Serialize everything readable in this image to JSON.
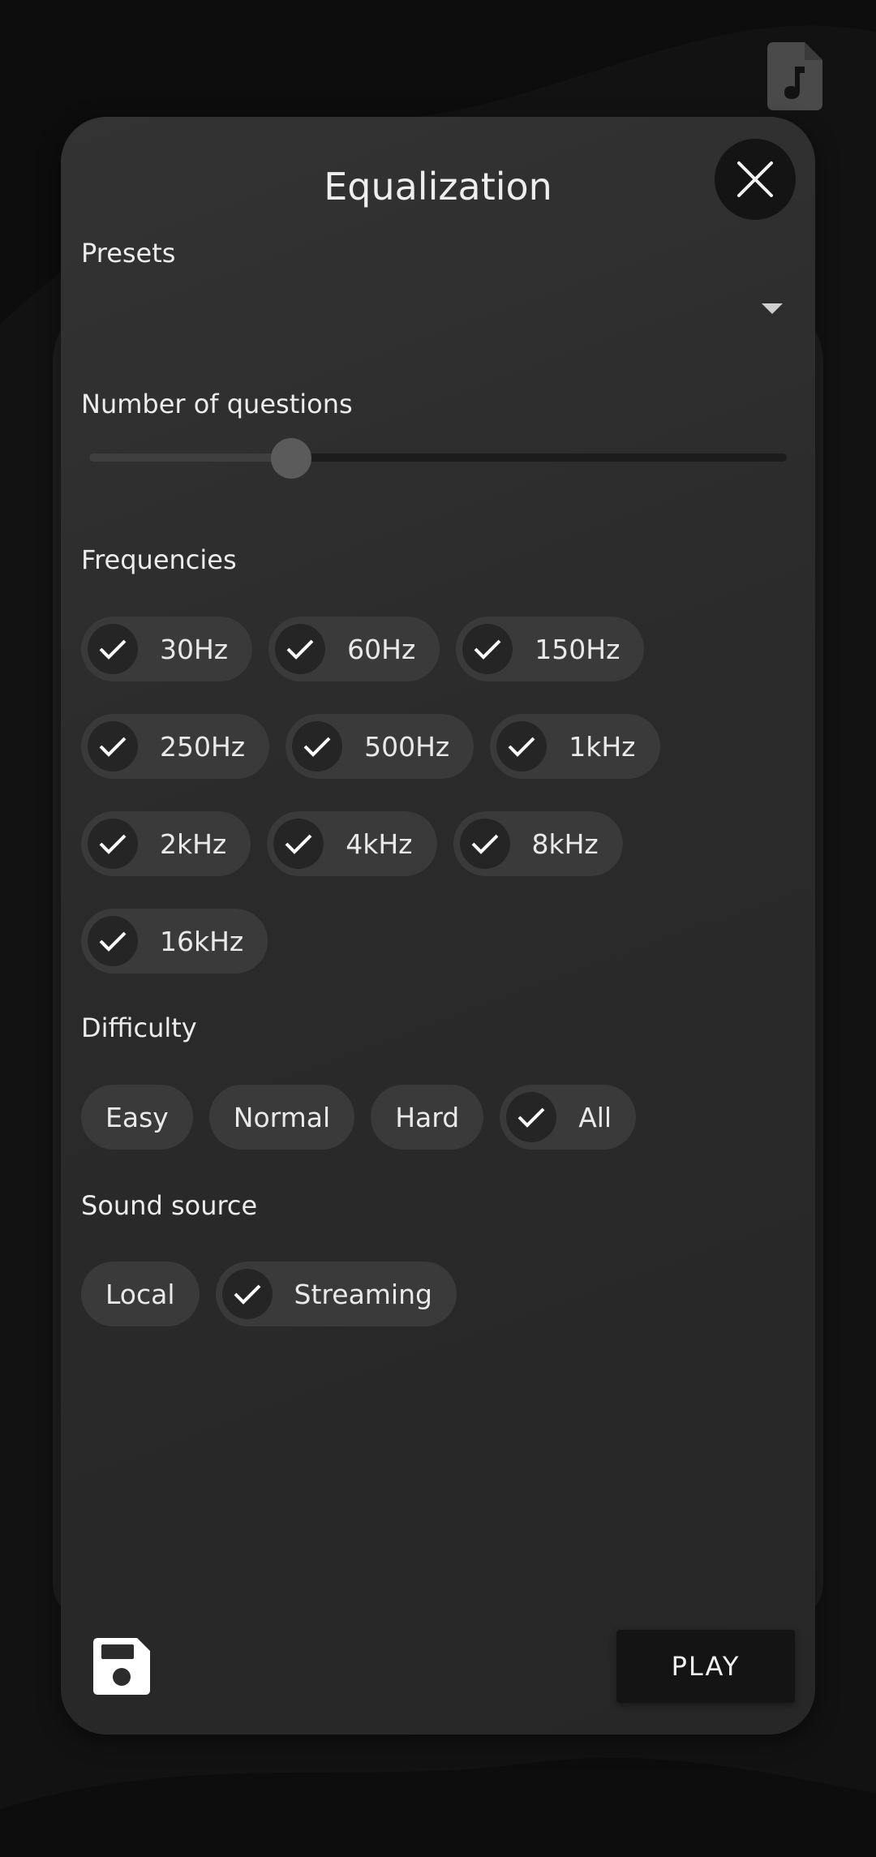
{
  "dialog": {
    "title": "Equalization",
    "close_icon": "close-icon"
  },
  "presets": {
    "label": "Presets",
    "selected_value": ""
  },
  "questions": {
    "label": "Number of questions",
    "slider_level_fraction": 0.29
  },
  "frequencies": {
    "label": "Frequencies",
    "options": [
      {
        "label": "30Hz",
        "selected": true
      },
      {
        "label": "60Hz",
        "selected": true
      },
      {
        "label": "150Hz",
        "selected": true
      },
      {
        "label": "250Hz",
        "selected": true
      },
      {
        "label": "500Hz",
        "selected": true
      },
      {
        "label": "1kHz",
        "selected": true
      },
      {
        "label": "2kHz",
        "selected": true
      },
      {
        "label": "4kHz",
        "selected": true
      },
      {
        "label": "8kHz",
        "selected": true
      },
      {
        "label": "16kHz",
        "selected": true
      }
    ]
  },
  "difficulty": {
    "label": "Difficulty",
    "options": [
      {
        "label": "Easy",
        "selected": false
      },
      {
        "label": "Normal",
        "selected": false
      },
      {
        "label": "Hard",
        "selected": false
      },
      {
        "label": "All",
        "selected": true
      }
    ]
  },
  "sound_source": {
    "label": "Sound source",
    "options": [
      {
        "label": "Local",
        "selected": false
      },
      {
        "label": "Streaming",
        "selected": true
      }
    ]
  },
  "footer": {
    "save_icon": "save-icon",
    "play_label": "PLAY"
  },
  "colors": {
    "background": "#121212",
    "modal": "#2e2e2e",
    "chip": "#3a3a3a",
    "check_circle": "#252525",
    "text": "#ececec"
  }
}
